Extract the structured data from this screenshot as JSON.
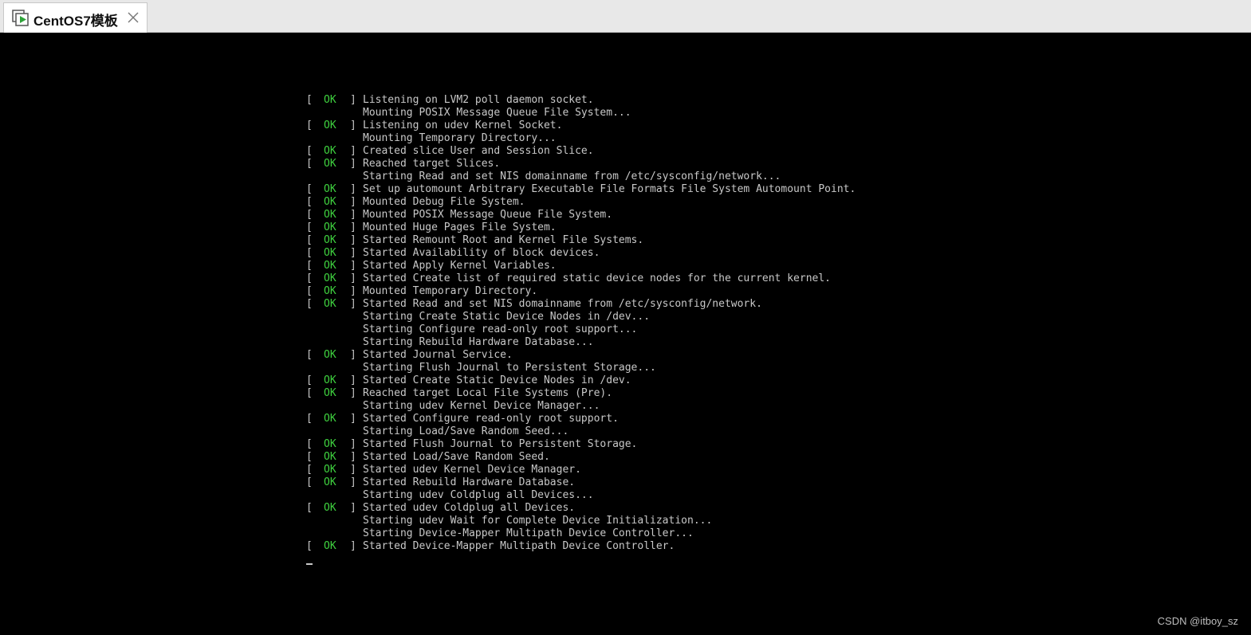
{
  "tab": {
    "title": "CentOS7模板",
    "icon": "vm-icon",
    "close_icon": "close-icon"
  },
  "console": {
    "lines": [
      {
        "status": "OK",
        "text": "Listening on LVM2 poll daemon socket."
      },
      {
        "status": "",
        "text": "Mounting POSIX Message Queue File System..."
      },
      {
        "status": "OK",
        "text": "Listening on udev Kernel Socket."
      },
      {
        "status": "",
        "text": "Mounting Temporary Directory..."
      },
      {
        "status": "OK",
        "text": "Created slice User and Session Slice."
      },
      {
        "status": "OK",
        "text": "Reached target Slices."
      },
      {
        "status": "",
        "text": "Starting Read and set NIS domainname from /etc/sysconfig/network..."
      },
      {
        "status": "OK",
        "text": "Set up automount Arbitrary Executable File Formats File System Automount Point."
      },
      {
        "status": "OK",
        "text": "Mounted Debug File System."
      },
      {
        "status": "OK",
        "text": "Mounted POSIX Message Queue File System."
      },
      {
        "status": "OK",
        "text": "Mounted Huge Pages File System."
      },
      {
        "status": "OK",
        "text": "Started Remount Root and Kernel File Systems."
      },
      {
        "status": "OK",
        "text": "Started Availability of block devices."
      },
      {
        "status": "OK",
        "text": "Started Apply Kernel Variables."
      },
      {
        "status": "OK",
        "text": "Started Create list of required static device nodes for the current kernel."
      },
      {
        "status": "OK",
        "text": "Mounted Temporary Directory."
      },
      {
        "status": "OK",
        "text": "Started Read and set NIS domainname from /etc/sysconfig/network."
      },
      {
        "status": "",
        "text": "Starting Create Static Device Nodes in /dev..."
      },
      {
        "status": "",
        "text": "Starting Configure read-only root support..."
      },
      {
        "status": "",
        "text": "Starting Rebuild Hardware Database..."
      },
      {
        "status": "OK",
        "text": "Started Journal Service."
      },
      {
        "status": "",
        "text": "Starting Flush Journal to Persistent Storage..."
      },
      {
        "status": "OK",
        "text": "Started Create Static Device Nodes in /dev."
      },
      {
        "status": "OK",
        "text": "Reached target Local File Systems (Pre)."
      },
      {
        "status": "",
        "text": "Starting udev Kernel Device Manager..."
      },
      {
        "status": "OK",
        "text": "Started Configure read-only root support."
      },
      {
        "status": "",
        "text": "Starting Load/Save Random Seed..."
      },
      {
        "status": "OK",
        "text": "Started Flush Journal to Persistent Storage."
      },
      {
        "status": "OK",
        "text": "Started Load/Save Random Seed."
      },
      {
        "status": "OK",
        "text": "Started udev Kernel Device Manager."
      },
      {
        "status": "OK",
        "text": "Started Rebuild Hardware Database."
      },
      {
        "status": "",
        "text": "Starting udev Coldplug all Devices..."
      },
      {
        "status": "OK",
        "text": "Started udev Coldplug all Devices."
      },
      {
        "status": "",
        "text": "Starting udev Wait for Complete Device Initialization..."
      },
      {
        "status": "",
        "text": "Starting Device-Mapper Multipath Device Controller..."
      },
      {
        "status": "OK",
        "text": "Started Device-Mapper Multipath Device Controller."
      }
    ]
  },
  "watermark": "CSDN @itboy_sz",
  "colors": {
    "ok": "#3fd13f",
    "text": "#c8c8c8",
    "background": "#000000"
  }
}
